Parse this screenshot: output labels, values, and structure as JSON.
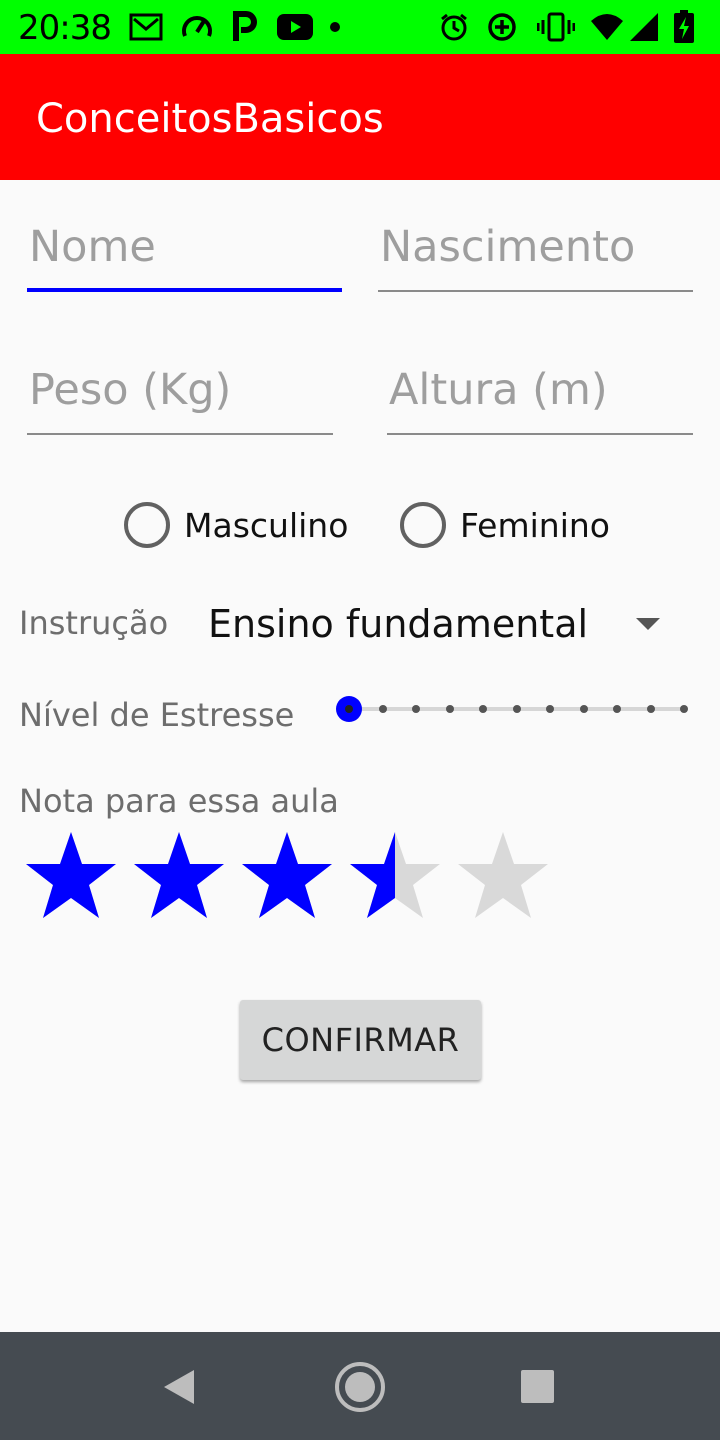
{
  "status_bar": {
    "time": "20:38",
    "color": "#00ff00",
    "icons_left": [
      "gmail-icon",
      "gauge-icon",
      "p-app-icon",
      "youtube-icon",
      "dot-icon"
    ],
    "icons_right": [
      "alarm-icon",
      "data-saver-icon",
      "vibrate-icon",
      "wifi-icon",
      "signal-icon",
      "battery-charging-icon"
    ]
  },
  "app_bar": {
    "title": "ConceitosBasicos",
    "color": "#ff0000"
  },
  "form": {
    "nome_placeholder": "Nome",
    "nascimento_placeholder": "Nascimento",
    "peso_placeholder": "Peso (Kg)",
    "altura_placeholder": "Altura (m)",
    "gender": {
      "options": [
        "Masculino",
        "Feminino"
      ],
      "selected": null
    },
    "instrucao_label": "Instrução",
    "instrucao_value": "Ensino fundamental",
    "estresse_label": "Nível de Estresse",
    "estresse_value": 0,
    "estresse_max": 10,
    "nota_label": "Nota para essa aula",
    "rating_value": 3.5,
    "rating_max": 5,
    "accent_color": "#0000ff",
    "confirm_label": "CONFIRMAR"
  },
  "nav_bar": {
    "buttons": [
      "back-icon",
      "home-icon",
      "recents-icon"
    ]
  }
}
